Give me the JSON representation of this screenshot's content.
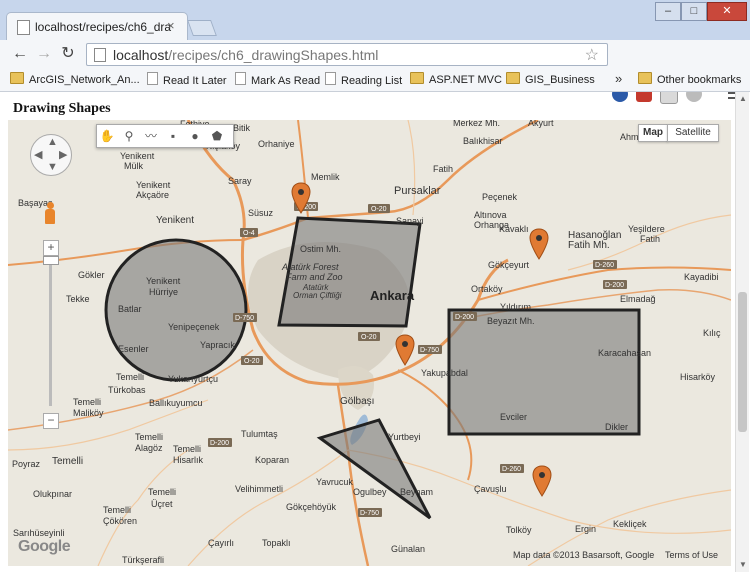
{
  "browser": {
    "tab_title": "localhost/recipes/ch6_dra",
    "tab_close": "×",
    "url_host": "localhost",
    "url_path": "/recipes/ch6_drawingShapes.html",
    "min_label": "–",
    "max_label": "□",
    "close_label": "✕",
    "back": "←",
    "forward": "→",
    "reload": "↻",
    "star": "☆"
  },
  "bookmarks": [
    {
      "label": "ArcGIS_Network_An...",
      "icon": "folder"
    },
    {
      "label": "Read It Later",
      "icon": "page"
    },
    {
      "label": "Mark As Read",
      "icon": "page"
    },
    {
      "label": "Reading List",
      "icon": "page"
    },
    {
      "label": "ASP.NET MVC",
      "icon": "folder"
    },
    {
      "label": "GIS_Business",
      "icon": "folder"
    },
    {
      "label": "Other bookmarks",
      "icon": "folder"
    }
  ],
  "bookmarks_overflow": "»",
  "page": {
    "heading": "Drawing Shapes"
  },
  "map": {
    "type_map": "Map",
    "type_satellite": "Satellite",
    "zoom_in": "+",
    "zoom_out": "−",
    "attribution": "Map data ©2013 Basarsoft, Google",
    "terms": "Terms of Use",
    "logo": "Google",
    "drawing_tools": [
      "hand-icon",
      "marker-icon",
      "polyline-icon",
      "rectangle-icon",
      "circle-icon",
      "polygon-icon"
    ],
    "place_labels": [
      {
        "text": "Merkez Mh."
      },
      {
        "text": "Akyurt"
      },
      {
        "text": "Ahmetadil"
      },
      {
        "text": "Fethiye"
      },
      {
        "text": "Bitik"
      },
      {
        "text": "Balıkhisar"
      },
      {
        "text": "Yenikent"
      },
      {
        "text": "Mülk"
      },
      {
        "text": "Kışlaköy"
      },
      {
        "text": "Orhaniye"
      },
      {
        "text": "Fatih"
      },
      {
        "text": "Saray"
      },
      {
        "text": "Memlik"
      },
      {
        "text": "Pursaklar"
      },
      {
        "text": "Yenikent"
      },
      {
        "text": "Akçaöre"
      },
      {
        "text": "Peçenek"
      },
      {
        "text": "Başayaş"
      },
      {
        "text": "Yenikent"
      },
      {
        "text": "Süsuz"
      },
      {
        "text": "Sanayi"
      },
      {
        "text": "Altınova"
      },
      {
        "text": "Orhanga"
      },
      {
        "text": "Kavaklı"
      },
      {
        "text": "Hasanoğlan"
      },
      {
        "text": "Yeşildere"
      },
      {
        "text": "Fatih Mh."
      },
      {
        "text": "Fatih"
      },
      {
        "text": "Ostim Mh."
      },
      {
        "text": "Atatürk Forest"
      },
      {
        "text": "Farm and Zoo"
      },
      {
        "text": "Atatürk"
      },
      {
        "text": "Orman Çiftliği"
      },
      {
        "text": "Ankara"
      },
      {
        "text": "Gökçeyurt"
      },
      {
        "text": "Kayadibi"
      },
      {
        "text": "Gökler"
      },
      {
        "text": "Tekke"
      },
      {
        "text": "Ortaköy"
      },
      {
        "text": "Yıldırım"
      },
      {
        "text": "Elmadağ"
      },
      {
        "text": "Yenikent"
      },
      {
        "text": "Hürriye"
      },
      {
        "text": "Batlar"
      },
      {
        "text": "Yenipeçenek"
      },
      {
        "text": "Esenler"
      },
      {
        "text": "Yapracık"
      },
      {
        "text": "Beyazıt Mh."
      },
      {
        "text": "Karacahasan"
      },
      {
        "text": "Kılıç"
      },
      {
        "text": "Temelli"
      },
      {
        "text": "Türkobas"
      },
      {
        "text": "Yukarıyurtçu"
      },
      {
        "text": "Yakupabdal"
      },
      {
        "text": "Hisarköy"
      },
      {
        "text": "Temelli"
      },
      {
        "text": "Maliköy"
      },
      {
        "text": "Ballıkuyumcu"
      },
      {
        "text": "Gölbaşı"
      },
      {
        "text": "Evciler"
      },
      {
        "text": "Dikler"
      },
      {
        "text": "Temelli"
      },
      {
        "text": "Alagöz"
      },
      {
        "text": "Tulumtaş"
      },
      {
        "text": "Yurtbeyi"
      },
      {
        "text": "Poyraz"
      },
      {
        "text": "Temelli"
      },
      {
        "text": "Temelli"
      },
      {
        "text": "Hisarlık"
      },
      {
        "text": "Koparan"
      },
      {
        "text": "Olukpınar"
      },
      {
        "text": "Velihimmetli"
      },
      {
        "text": "Yavrucuk"
      },
      {
        "text": "Ogulbey"
      },
      {
        "text": "Beynam"
      },
      {
        "text": "Çavuşlu"
      },
      {
        "text": "Temelli"
      },
      {
        "text": "Üçret"
      },
      {
        "text": "Temelli"
      },
      {
        "text": "Çökören"
      },
      {
        "text": "Gökçehöyük"
      },
      {
        "text": "Tolköy"
      },
      {
        "text": "Ergin"
      },
      {
        "text": "Kekliçek"
      },
      {
        "text": "Sarıhüseyinli"
      },
      {
        "text": "Çayırlı"
      },
      {
        "text": "Topaklı"
      },
      {
        "text": "Günalan"
      },
      {
        "text": "Türkşerafli"
      }
    ],
    "road_shields": [
      {
        "text": "D-200"
      },
      {
        "text": "O-4"
      },
      {
        "text": "O-20"
      },
      {
        "text": "O-20"
      },
      {
        "text": "D-750"
      },
      {
        "text": "D-200"
      },
      {
        "text": "D-260"
      },
      {
        "text": "D-750"
      },
      {
        "text": "D-200"
      },
      {
        "text": "O-20"
      },
      {
        "text": "D-200"
      },
      {
        "text": "D-750"
      },
      {
        "text": "D-260"
      }
    ]
  }
}
